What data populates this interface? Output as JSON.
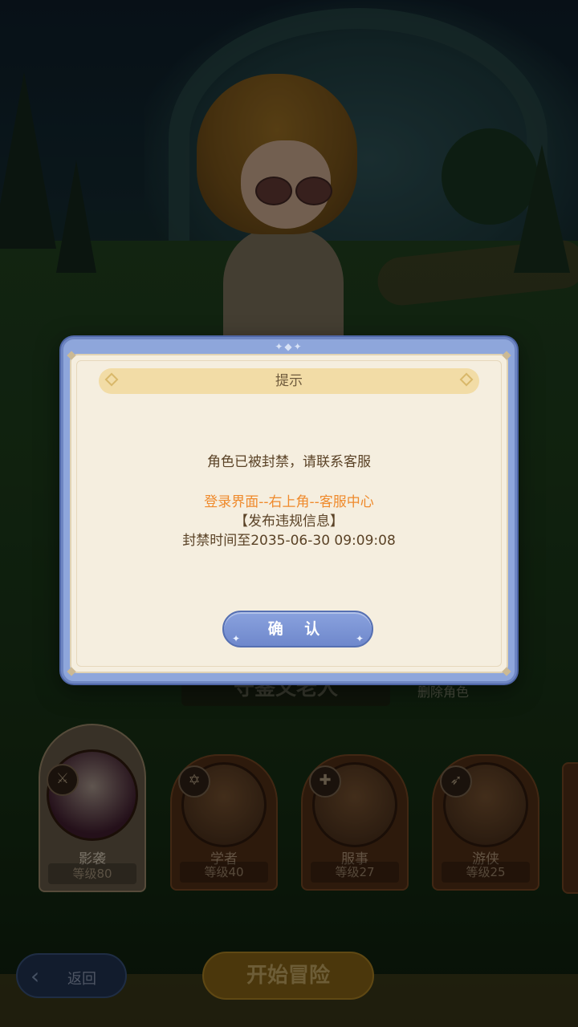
{
  "dialog": {
    "title": "提示",
    "message": "角色已被封禁，请联系客服",
    "path_hint": "登录界面--右上角--客服中心",
    "reason": "【发布违规信息】",
    "ban_until": "封禁时间至2035-06-30  09:09:08",
    "confirm_label": "确 认",
    "accent_color": "#8ea6db",
    "hint_color": "#ef8a2c"
  },
  "background": {
    "name_plate": "守鉴又老人",
    "delete_role_label": "删除角色"
  },
  "characters": [
    {
      "class": "影袭",
      "level": "等级80",
      "class_icon": "swords-icon",
      "selected": true
    },
    {
      "class": "学者",
      "level": "等级40",
      "class_icon": "hexagram-icon",
      "selected": false
    },
    {
      "class": "服事",
      "level": "等级27",
      "class_icon": "cross-icon",
      "selected": false
    },
    {
      "class": "游侠",
      "level": "等级25",
      "class_icon": "bow-icon",
      "selected": false
    }
  ],
  "footer": {
    "back_label": "返回",
    "start_label": "开始冒险"
  }
}
